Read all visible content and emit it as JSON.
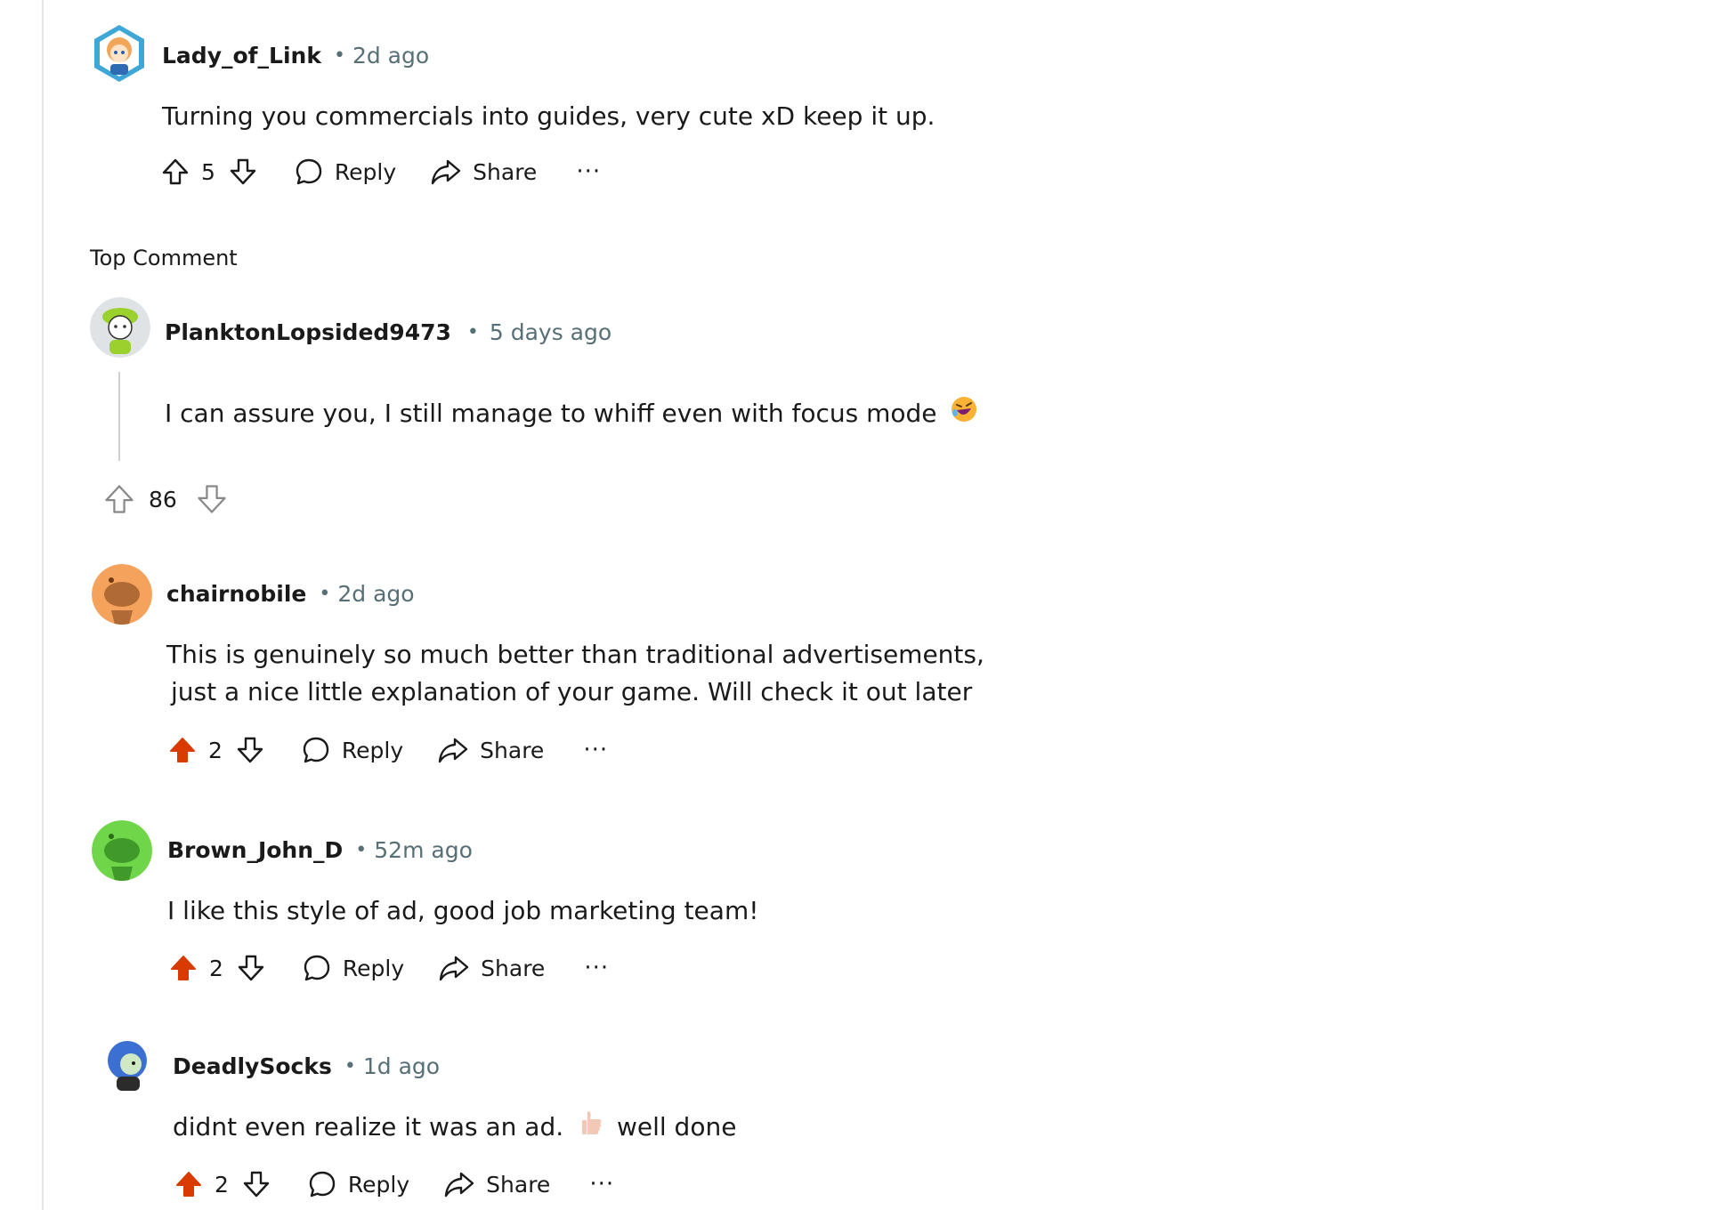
{
  "section_label": "Top Comment",
  "colors": {
    "upvoted": "#d93a00",
    "meta": "#576f76"
  },
  "comments": [
    {
      "username": "Lady_of_Link",
      "time": "2d ago",
      "body": "Turning you commercials into guides, very cute xD keep it up.",
      "votes": "5",
      "upvoted": false,
      "reply_label": "Reply",
      "share_label": "Share",
      "more_label": "···",
      "avatar": "anime-avatar-icon"
    },
    {
      "username": "PlanktonLopsided9473",
      "time": "5 days ago",
      "body": "I can assure you, I still manage to whiff even with focus mode",
      "emoji": "laughing-emoji-icon",
      "votes": "86",
      "upvoted": false,
      "avatar": "green-hat-avatar-icon"
    },
    {
      "username": "chairnobile",
      "time": "2d ago",
      "body_line1": "This is genuinely so much better than traditional advertisements,",
      "body_line2": "just a nice little explanation of your game.  Will check it out later",
      "votes": "2",
      "upvoted": true,
      "reply_label": "Reply",
      "share_label": "Share",
      "more_label": "···",
      "avatar": "orange-snoo-avatar-icon"
    },
    {
      "username": "Brown_John_D",
      "time": "52m ago",
      "body": "I like this style of ad, good job marketing team!",
      "votes": "2",
      "upvoted": true,
      "reply_label": "Reply",
      "share_label": "Share",
      "more_label": "···",
      "avatar": "green-snoo-avatar-icon"
    },
    {
      "username": "DeadlySocks",
      "time": "1d ago",
      "body_before": "didnt even realize it was an ad.",
      "body_after": "well done",
      "emoji": "thumbs-up-emoji-icon",
      "votes": "2",
      "upvoted": true,
      "reply_label": "Reply",
      "share_label": "Share",
      "more_label": "···",
      "avatar": "blue-hair-avatar-icon"
    }
  ]
}
